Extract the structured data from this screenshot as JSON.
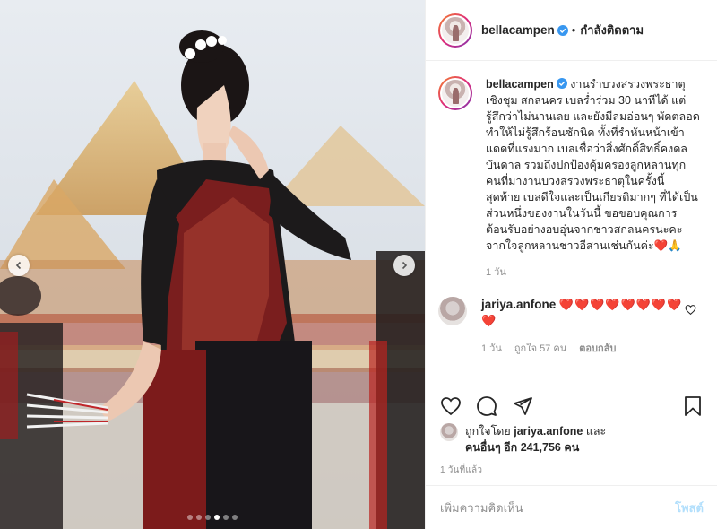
{
  "post": {
    "username": "bellacampen",
    "follow_status": "กำลังติดตาม",
    "separator": "•",
    "caption": "งานรำบวงสรวงพระธาตุเชิงชุม สกลนคร เบลร่ำร่วม 30 นาทีได้ แต่รู้สึกว่าไม่นานเลย และยังมีลมอ่อนๆ พัดตลอดทำให้ไม่รู้สึกร้อนซักนิด ทั้งที่รำหันหน้าเข้าแดดที่แรงมาก เบลเชื่อว่าสิ่งศักดิ์สิทธิ์คงดลบันดาล รวมถึงปกป้องคุ้มครองลูกหลานทุกคนที่มางานบวงสรวงพระธาตุในครั้งนี้ สุดท้าย เบลดีใจและเป็นเกียรติมากๆ ที่ได้เป็นส่วนหนึ่งของงานในวันนี้ ขอขอบคุณการต้อนรับอย่างอบอุ่นจากชาวสกลนครนะคะ จากใจลูกหลานชาวอีสานเช่นกันค่ะ",
    "caption_emoji": "❤️🙏",
    "caption_time": "1 วัน"
  },
  "comment": {
    "username": "jariya.anfone",
    "text": "❤️❤️❤️❤️❤️❤️❤️❤️❤️",
    "time": "1 วัน",
    "likes": "ถูกใจ 57 คน",
    "reply_label": "ตอบกลับ"
  },
  "likes": {
    "line1_prefix": "ถูกใจโดย",
    "line1_user": "jariya.anfone",
    "line1_suffix": "และ",
    "line2": "คนอื่นๆ อีก 241,756 คน"
  },
  "time_ago": "1 วันที่แล้ว",
  "comment_box": {
    "placeholder": "เพิ่มความคิดเห็น",
    "post_label": "โพสต์"
  },
  "carousel": {
    "count": 6,
    "active_index": 3
  },
  "icons": {
    "like": "heart-icon",
    "comment": "comment-icon",
    "share": "share-icon",
    "save": "bookmark-icon",
    "verified": "verified-badge-icon",
    "prev": "chevron-left-icon",
    "next": "chevron-right-icon"
  },
  "colors": {
    "verified": "#3897f0",
    "heart_red": "#e0182d",
    "post_button": "#b2dffc",
    "muted_text": "#8e8e8e"
  }
}
